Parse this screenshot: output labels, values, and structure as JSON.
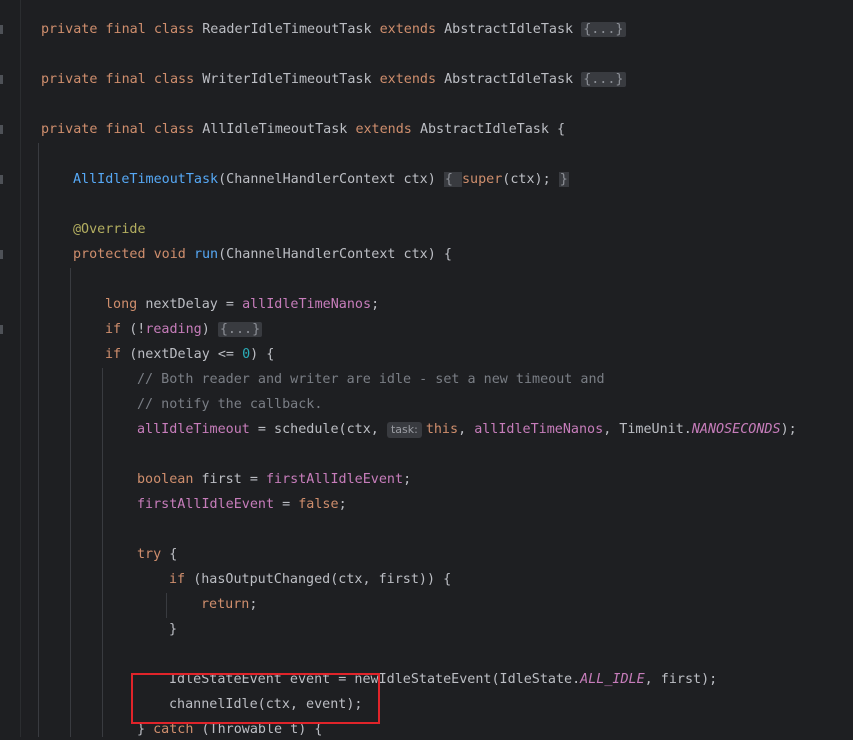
{
  "editor": {
    "lines": [
      {
        "segments": [
          [
            "kw",
            "private final class "
          ],
          [
            "ty",
            "ReaderIdleTimeoutTask "
          ],
          [
            "kw",
            "extends "
          ],
          [
            "ty",
            "AbstractIdleTask "
          ],
          [
            "fold",
            "{...}"
          ]
        ]
      },
      {
        "segments": [
          [
            "kw",
            "private final class "
          ],
          [
            "ty",
            "WriterIdleTimeoutTask "
          ],
          [
            "kw",
            "extends "
          ],
          [
            "ty",
            "AbstractIdleTask "
          ],
          [
            "fold",
            "{...}"
          ]
        ]
      },
      {
        "segments": [
          [
            "kw",
            "private final class "
          ],
          [
            "ty",
            "AllIdleTimeoutTask "
          ],
          [
            "kw",
            "extends "
          ],
          [
            "ty",
            "AbstractIdleTask {"
          ]
        ]
      },
      {
        "segments": [
          [
            "fn",
            "AllIdleTimeoutTask"
          ],
          [
            "ty",
            "(ChannelHandlerContext ctx) "
          ],
          [
            "braceBox",
            "{ "
          ],
          [
            "kw",
            "super"
          ],
          [
            "ty",
            "(ctx); "
          ],
          [
            "braceBox",
            "}"
          ]
        ]
      },
      {
        "segments": [
          [
            "ann",
            "@Override"
          ]
        ]
      },
      {
        "segments": [
          [
            "kw",
            "protected void "
          ],
          [
            "fn",
            "run"
          ],
          [
            "ty",
            "(ChannelHandlerContext ctx) {"
          ]
        ]
      },
      {
        "segments": [
          [
            "kw",
            "long "
          ],
          [
            "ty",
            "nextDelay = "
          ],
          [
            "mem",
            "allIdleTimeNanos"
          ],
          [
            "ty",
            ";"
          ]
        ]
      },
      {
        "segments": [
          [
            "kw",
            "if "
          ],
          [
            "ty",
            "(!"
          ],
          [
            "mem",
            "reading"
          ],
          [
            "ty",
            ") "
          ],
          [
            "fold",
            "{...}"
          ]
        ]
      },
      {
        "segments": [
          [
            "kw",
            "if "
          ],
          [
            "ty",
            "(nextDelay <= "
          ],
          [
            "num",
            "0"
          ],
          [
            "ty",
            ") {"
          ]
        ]
      },
      {
        "segments": [
          [
            "cm",
            "// Both reader and writer are idle - set a new timeout and"
          ]
        ]
      },
      {
        "segments": [
          [
            "cm",
            "// notify the callback."
          ]
        ]
      },
      {
        "segments": [
          [
            "mem",
            "allIdleTimeout"
          ],
          [
            "ty",
            " = schedule(ctx, "
          ],
          [
            "hint",
            "task:"
          ],
          [
            "kw",
            "this"
          ],
          [
            "ty",
            ", "
          ],
          [
            "mem",
            "allIdleTimeNanos"
          ],
          [
            "ty",
            ", TimeUnit."
          ],
          [
            "const",
            "NANOSECONDS"
          ],
          [
            "ty",
            ");"
          ]
        ]
      },
      {
        "segments": [
          [
            "kw",
            "boolean "
          ],
          [
            "ty",
            "first = "
          ],
          [
            "mem",
            "firstAllIdleEvent"
          ],
          [
            "ty",
            ";"
          ]
        ]
      },
      {
        "segments": [
          [
            "mem",
            "firstAllIdleEvent"
          ],
          [
            "ty",
            " = "
          ],
          [
            "kw",
            "false"
          ],
          [
            "ty",
            ";"
          ]
        ]
      },
      {
        "segments": [
          [
            "kw",
            "try "
          ],
          [
            "ty",
            "{"
          ]
        ]
      },
      {
        "segments": [
          [
            "kw",
            "if "
          ],
          [
            "ty",
            "(hasOutputChanged(ctx, first)) {"
          ]
        ]
      },
      {
        "segments": [
          [
            "kw",
            "return"
          ],
          [
            "ty",
            ";"
          ]
        ]
      },
      {
        "segments": [
          [
            "ty",
            "}"
          ]
        ]
      },
      {
        "segments": [
          [
            "ty",
            "IdleStateEvent event = newIdleStateEvent(IdleState."
          ],
          [
            "const",
            "ALL_IDLE"
          ],
          [
            "ty",
            ", first);"
          ]
        ]
      },
      {
        "segments": [
          [
            "ty",
            "channelIdle(ctx, event);"
          ]
        ]
      },
      {
        "segments": [
          [
            "ty",
            "} "
          ],
          [
            "kw",
            "catch "
          ],
          [
            "ty",
            "(Throwable t) {"
          ]
        ]
      }
    ]
  },
  "colors": {
    "background": "#1e1f22",
    "keyword": "#cf8e6d",
    "function": "#56a8f5",
    "member": "#c77dbb",
    "number": "#2aacb8",
    "comment": "#7a7e85",
    "annotation": "#b3ae60",
    "highlight_box": "#e0242a"
  }
}
